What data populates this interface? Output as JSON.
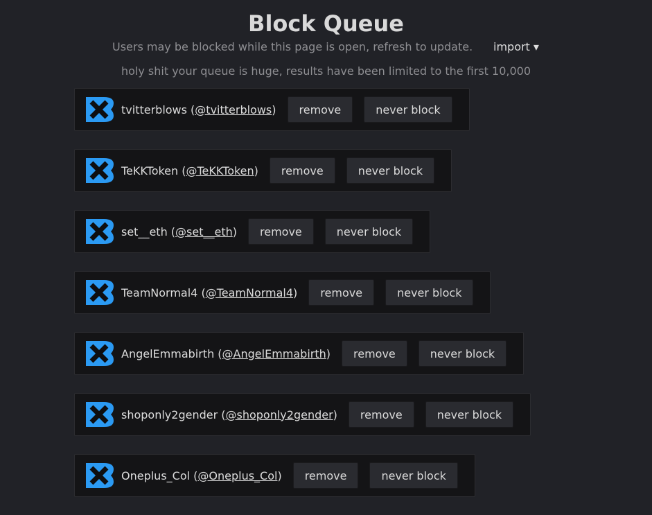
{
  "header": {
    "title": "Block Queue",
    "subtitle": "Users may be blocked while this page is open, refresh to update.",
    "import_label": "import ▾",
    "notice": "holy shit your queue is huge, results have been limited to the first 10,000"
  },
  "colors": {
    "background": "#212227",
    "card": "#141416",
    "button": "#2a2b30",
    "logo_blue": "#2b9af3",
    "logo_x": "#0e0e10"
  },
  "icon": "blue-x-logo-icon",
  "entries": [
    {
      "name": "tvitterblows",
      "handle": "@tvitterblows",
      "remove": "remove",
      "never_block": "never block"
    },
    {
      "name": "TeKKToken",
      "handle": "@TeKKToken",
      "remove": "remove",
      "never_block": "never block"
    },
    {
      "name": "set__eth",
      "handle": "@set__eth",
      "remove": "remove",
      "never_block": "never block"
    },
    {
      "name": "TeamNormal4",
      "handle": "@TeamNormal4",
      "remove": "remove",
      "never_block": "never block"
    },
    {
      "name": "AngelEmmabirth",
      "handle": "@AngelEmmabirth",
      "remove": "remove",
      "never_block": "never block"
    },
    {
      "name": "shoponly2gender",
      "handle": "@shoponly2gender",
      "remove": "remove",
      "never_block": "never block"
    },
    {
      "name": "Oneplus_Col",
      "handle": "@Oneplus_Col",
      "remove": "remove",
      "never_block": "never block"
    }
  ]
}
